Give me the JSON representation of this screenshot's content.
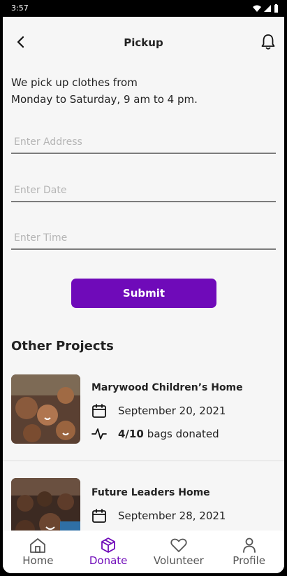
{
  "status": {
    "time": "3:57"
  },
  "header": {
    "title": "Pickup"
  },
  "intro": {
    "line1": "We pick up clothes from",
    "line2": "Monday to Saturday, 9 am to 4 pm."
  },
  "form": {
    "address_placeholder": "Enter Address",
    "date_placeholder": "Enter Date",
    "time_placeholder": "Enter Time",
    "submit_label": "Submit"
  },
  "other_projects": {
    "title": "Other Projects",
    "items": [
      {
        "name": "Marywood Children’s Home",
        "date": "September 20, 2021",
        "bags_count": "4/10",
        "bags_text": "bags donated"
      },
      {
        "name": "Future Leaders Home",
        "date": "September 28, 2021"
      }
    ]
  },
  "nav": {
    "items": [
      {
        "label": "Home",
        "icon": "home-icon"
      },
      {
        "label": "Donate",
        "icon": "box-icon"
      },
      {
        "label": "Volunteer",
        "icon": "heart-icon"
      },
      {
        "label": "Profile",
        "icon": "person-icon"
      }
    ]
  },
  "colors": {
    "accent": "#6f0ab9",
    "background": "#f6f6f6"
  }
}
